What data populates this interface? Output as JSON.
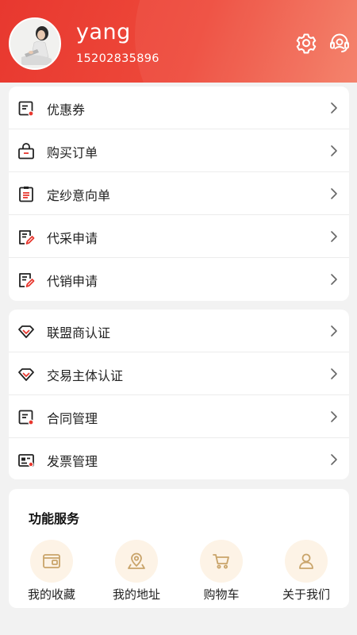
{
  "profile": {
    "username": "yang",
    "phone": "15202835896"
  },
  "header_icons": {
    "settings": "gear-icon",
    "service": "customer-service-icon"
  },
  "colors": {
    "brand_red": "#e8382f",
    "accent_gold": "#c9a46a",
    "icon_bg": "#fdf3e6"
  },
  "menu_group_1": [
    {
      "label": "优惠券",
      "icon": "coupon-icon"
    },
    {
      "label": "购买订单",
      "icon": "shopping-bag-icon"
    },
    {
      "label": "定纱意向单",
      "icon": "clipboard-icon"
    },
    {
      "label": "代采申请",
      "icon": "edit-document-icon"
    },
    {
      "label": "代销申请",
      "icon": "edit-document-icon"
    }
  ],
  "menu_group_2": [
    {
      "label": "联盟商认证",
      "icon": "diamond-icon"
    },
    {
      "label": "交易主体认证",
      "icon": "diamond-icon"
    },
    {
      "label": "合同管理",
      "icon": "contract-icon"
    },
    {
      "label": "发票管理",
      "icon": "invoice-icon"
    }
  ],
  "services": {
    "title": "功能服务",
    "items": [
      {
        "label": "我的收藏",
        "icon": "wallet-icon"
      },
      {
        "label": "我的地址",
        "icon": "location-icon"
      },
      {
        "label": "购物车",
        "icon": "cart-icon"
      },
      {
        "label": "关于我们",
        "icon": "person-icon"
      }
    ]
  }
}
